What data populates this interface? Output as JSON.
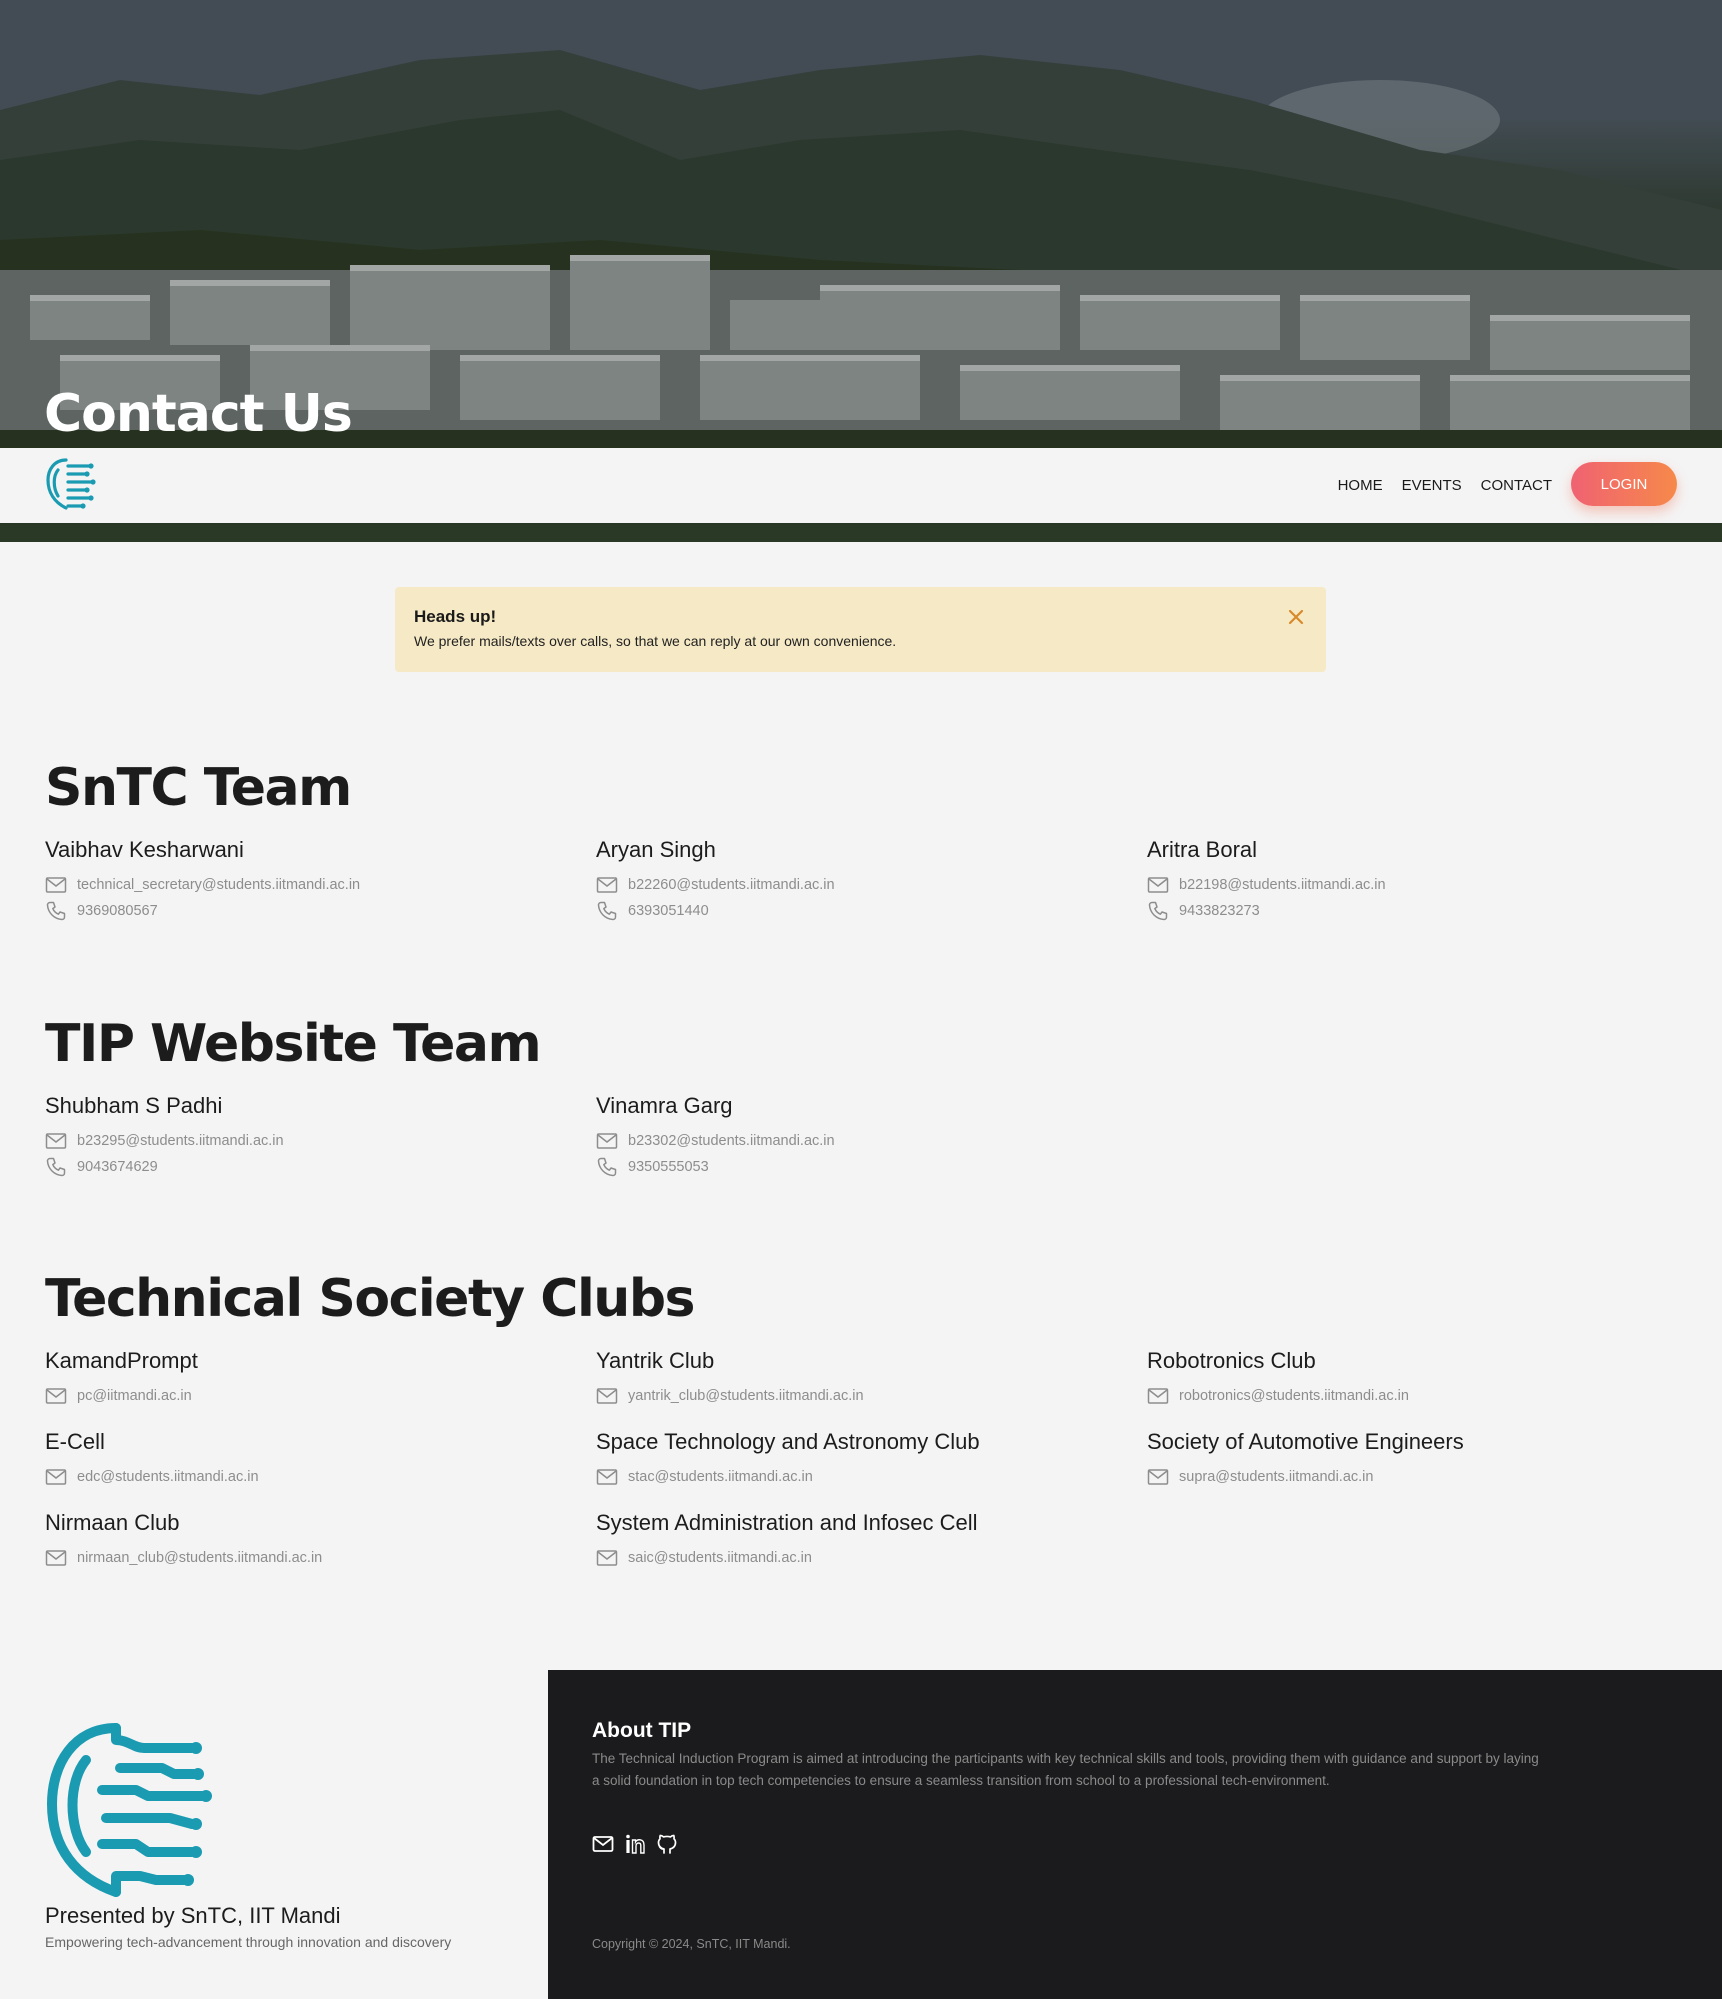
{
  "hero": {
    "title": "Contact Us"
  },
  "nav": {
    "links": [
      {
        "label": "HOME"
      },
      {
        "label": "EVENTS"
      },
      {
        "label": "CONTACT"
      }
    ],
    "login_label": "LOGIN"
  },
  "alert": {
    "title": "Heads up!",
    "text": "We prefer mails/texts over calls, so that we can reply at our own convenience."
  },
  "sections": [
    {
      "title": "SnTC Team",
      "people": [
        {
          "name": "Vaibhav Kesharwani",
          "email": "technical_secretary@students.iitmandi.ac.in",
          "phone": "9369080567"
        },
        {
          "name": "Aryan Singh",
          "email": "b22260@students.iitmandi.ac.in",
          "phone": "6393051440"
        },
        {
          "name": "Aritra Boral",
          "email": "b22198@students.iitmandi.ac.in",
          "phone": "9433823273"
        }
      ]
    },
    {
      "title": "TIP Website Team",
      "people": [
        {
          "name": "Shubham S Padhi",
          "email": "b23295@students.iitmandi.ac.in",
          "phone": "9043674629"
        },
        {
          "name": "Vinamra Garg",
          "email": "b23302@students.iitmandi.ac.in",
          "phone": "9350555053"
        }
      ]
    },
    {
      "title": "Technical Society Clubs",
      "people": [
        {
          "name": "KamandPrompt",
          "email": "pc@iitmandi.ac.in"
        },
        {
          "name": "Yantrik Club",
          "email": "yantrik_club@students.iitmandi.ac.in"
        },
        {
          "name": "Robotronics Club",
          "email": "robotronics@students.iitmandi.ac.in"
        },
        {
          "name": "E-Cell",
          "email": "edc@students.iitmandi.ac.in"
        },
        {
          "name": "Space Technology and Astronomy Club",
          "email": "stac@students.iitmandi.ac.in"
        },
        {
          "name": "Society of Automotive Engineers",
          "email": "supra@students.iitmandi.ac.in"
        },
        {
          "name": "Nirmaan Club",
          "email": "nirmaan_club@students.iitmandi.ac.in"
        },
        {
          "name": "System Administration and Infosec Cell",
          "email": "saic@students.iitmandi.ac.in"
        }
      ]
    }
  ],
  "footer": {
    "presented_by": "Presented by SnTC, IIT Mandi",
    "tagline": "Empowering tech-advancement through innovation and discovery",
    "about_title": "About TIP",
    "about_text": "The Technical Induction Program is aimed at introducing the participants with key technical skills and tools, providing them with guidance and support by laying a solid foundation in top tech competencies to ensure a seamless transition from school to a professional tech-environment.",
    "social_icons": [
      "mail-icon",
      "linkedin-icon",
      "github-icon"
    ],
    "copyright": "Copyright © 2024, SnTC, IIT Mandi."
  },
  "colors": {
    "accent_teal": "#1a9bb2",
    "login_gradient_start": "#f06272",
    "login_gradient_end": "#f6894a",
    "alert_bg": "#f6e9c5",
    "alert_close": "#d98a2a",
    "footer_dark": "#1b1b1d"
  }
}
